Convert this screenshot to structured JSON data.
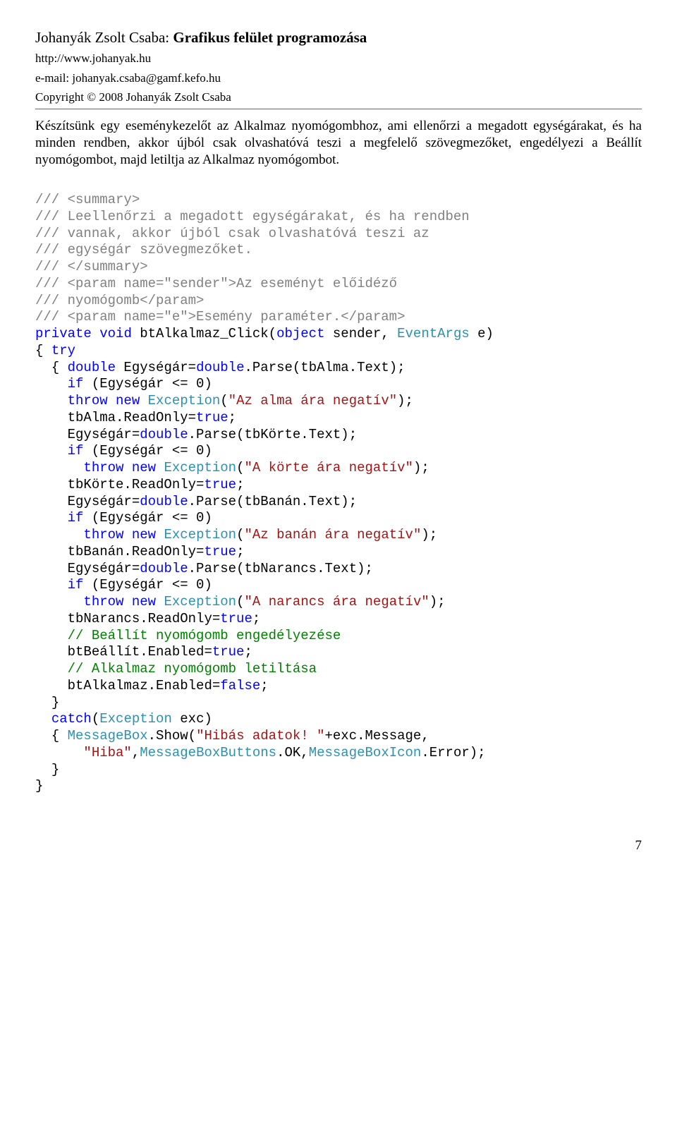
{
  "header": {
    "author": "Johanyák Zsolt Csaba: ",
    "title": "Grafikus felület programozása",
    "url": "http://www.johanyak.hu",
    "email": "e-mail: johanyak.csaba@gamf.kefo.hu",
    "copyright": "Copyright © 2008 Johanyák Zsolt Csaba"
  },
  "paragraph": "Készítsünk egy eseménykezelőt az Alkalmaz nyomógombhoz, ami ellenőrzi a megadott egységárakat, és ha minden rendben, akkor újból csak olvashatóvá teszi a megfelelő szövegmezőket, engedélyezi a Beállít nyomógombot, majd letiltja az Alkalmaz nyomógombot.",
  "code": {
    "l1": "/// <summary>",
    "l2": "/// Leellenőrzi a megadott egységárakat, és ha rendben",
    "l3": "/// vannak, akkor újból csak olvashatóvá teszi az",
    "l4": "/// egységár szövegmezőket.",
    "l5": "/// </summary>",
    "l6": "/// <param name=\"sender\">Az eseményt előidéző",
    "l7": "/// nyomógomb</param>",
    "l8": "/// <param name=\"e\">Esemény paraméter.</param>",
    "kw_private": "private",
    "kw_void": "void",
    "m_name": " btAlkalmaz_Click(",
    "kw_object": "object",
    "m_sender": " sender, ",
    "t_eventargs": "EventArgs",
    "m_e": " e)",
    "brace_open": "{ ",
    "kw_try": "try",
    "indent_brace_open": "  { ",
    "kw_double": "double",
    "eg_eq": " Egységár=",
    "parse_alma": ".Parse(tbAlma.Text);",
    "indent": "    ",
    "kw_if": "if",
    "cond": " (Egységár <= 0)",
    "kw_throw": "throw",
    "kw_new": "new",
    "t_exception": "Exception",
    "str_alma": "\"Az alma ára negatív\"",
    "close_paren_semi": ");",
    "tbalma_ro": "    tbAlma.ReadOnly=",
    "kw_true": "true",
    "semi": ";",
    "eg_eq2": "    Egységár=",
    "parse_korte": ".Parse(tbKörte.Text);",
    "indent6": "      ",
    "str_korte": "\"A körte ára negatív\"",
    "tbkorte_ro": "    tbKörte.ReadOnly=",
    "parse_banan": ".Parse(tbBanán.Text);",
    "str_banan": "\"Az banán ára negatív\"",
    "tbbanan_ro": "    tbBanán.ReadOnly=",
    "parse_narancs": ".Parse(tbNarancs.Text);",
    "str_narancs": "\"A narancs ára negatív\"",
    "tbnarancs_ro": "    tbNarancs.ReadOnly=",
    "comment1": "    // Beállít nyomógomb engedélyezése",
    "btbeallit": "    btBeállít.Enabled=",
    "comment2": "    // Alkalmaz nyomógomb letiltása",
    "btalkalmaz": "    btAlkalmaz.Enabled=",
    "kw_false": "false",
    "indent2": "  ",
    "brace_close": "}",
    "kw_catch": "catch",
    "catch_open": "(",
    "catch_exc": " exc)",
    "msgbox1": "  { ",
    "t_msgbox": "MessageBox",
    "msgbox_show": ".Show(",
    "str_hibas": "\"Hibás adatok! \"",
    "plus_exc": "+exc.Message,",
    "str_hiba": "\"Hiba\"",
    "comma": ",",
    "t_mbb": "MessageBoxButtons",
    "mbb_ok": ".OK,",
    "t_mbi": "MessageBoxIcon",
    "mbi_err": ".Error);"
  },
  "pageNumber": "7"
}
